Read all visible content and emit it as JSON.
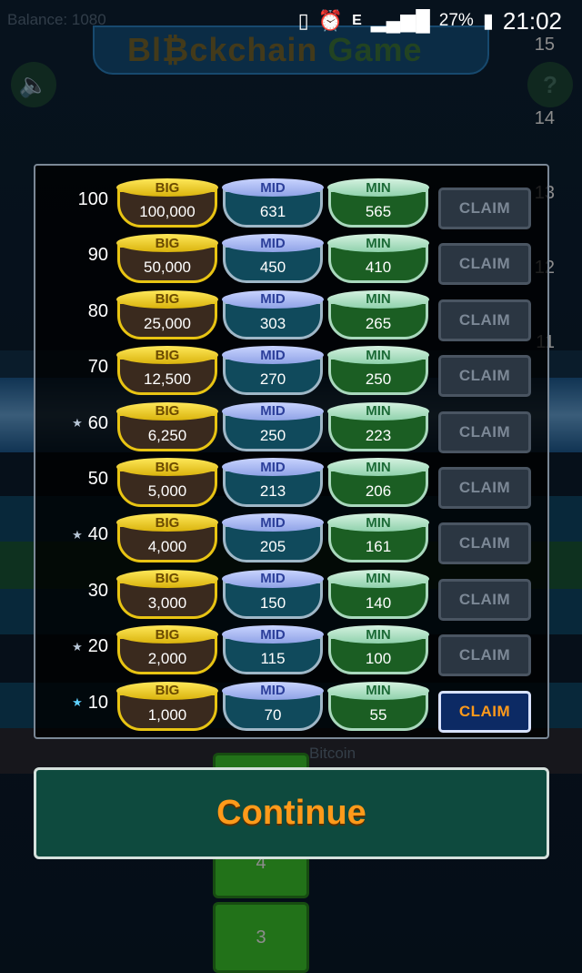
{
  "status_bar": {
    "battery": "27%",
    "time": "21:02",
    "icons": [
      "vibrate-icon",
      "alarm-icon",
      "data-e-icon",
      "signal-icon",
      "battery-icon"
    ],
    "data_label": "E"
  },
  "background": {
    "balance": "Balance: 1080",
    "title_a": "Bl",
    "title_coin": "₿",
    "title_b": "ckchain",
    "title_c": "Game",
    "help": "?",
    "levels": [
      "15",
      "14",
      "13",
      "12",
      "11"
    ],
    "steps": [
      "4",
      "3"
    ],
    "bitcoin_label": "Bitcoin"
  },
  "rewards": {
    "big_label": "BIG",
    "mid_label": "MID",
    "min_label": "MIN",
    "claim_label": "CLAIM",
    "rows": [
      {
        "level": "100",
        "star": false,
        "big": "100,000",
        "mid": "631",
        "min": "565",
        "claimable": false
      },
      {
        "level": "90",
        "star": false,
        "big": "50,000",
        "mid": "450",
        "min": "410",
        "claimable": false
      },
      {
        "level": "80",
        "star": false,
        "big": "25,000",
        "mid": "303",
        "min": "265",
        "claimable": false
      },
      {
        "level": "70",
        "star": false,
        "big": "12,500",
        "mid": "270",
        "min": "250",
        "claimable": false
      },
      {
        "level": "60",
        "star": true,
        "big": "6,250",
        "mid": "250",
        "min": "223",
        "claimable": false
      },
      {
        "level": "50",
        "star": false,
        "big": "5,000",
        "mid": "213",
        "min": "206",
        "claimable": false
      },
      {
        "level": "40",
        "star": true,
        "big": "4,000",
        "mid": "205",
        "min": "161",
        "claimable": false
      },
      {
        "level": "30",
        "star": false,
        "big": "3,000",
        "mid": "150",
        "min": "140",
        "claimable": false
      },
      {
        "level": "20",
        "star": true,
        "big": "2,000",
        "mid": "115",
        "min": "100",
        "claimable": false
      },
      {
        "level": "10",
        "star": true,
        "big": "1,000",
        "mid": "70",
        "min": "55",
        "claimable": true
      }
    ]
  },
  "continue_label": "Continue",
  "colors": {
    "accent_orange": "#ff9a1a",
    "big_gold": "#e8c413",
    "mid_blue": "#8fa2e6",
    "min_green": "#8fd1ac",
    "step_green": "#3ecf2e"
  }
}
